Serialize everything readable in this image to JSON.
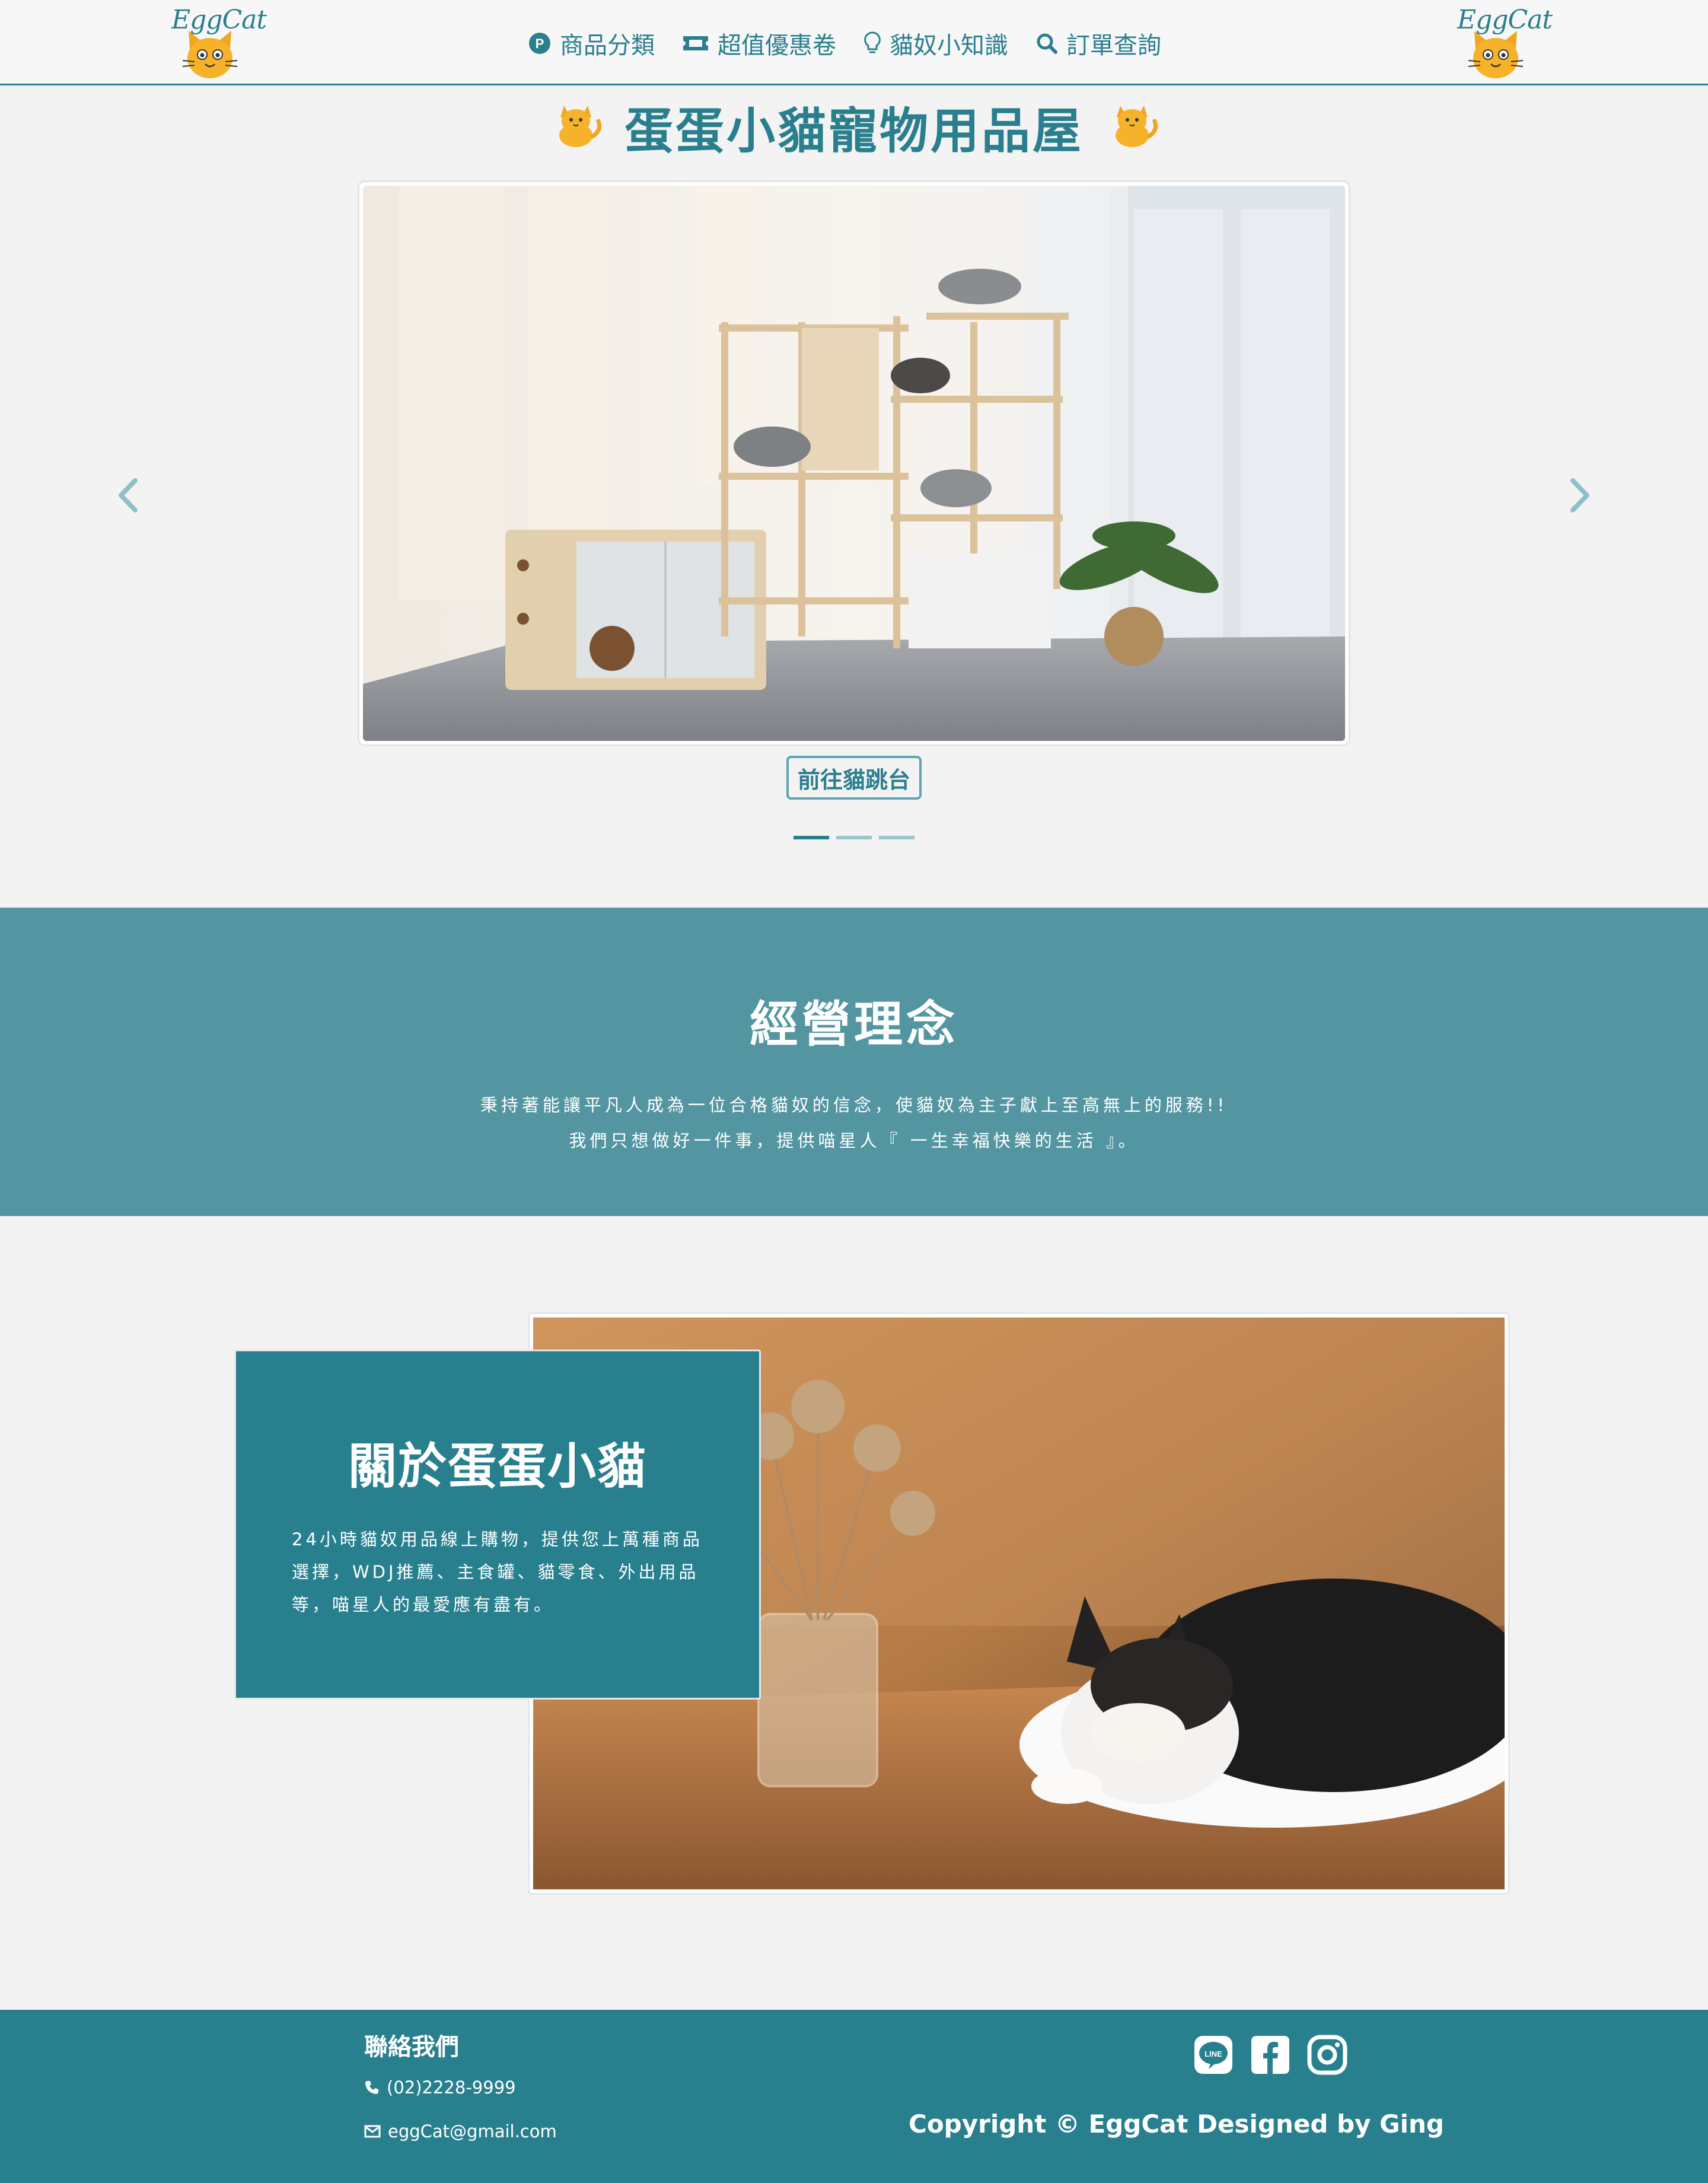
{
  "navbar": {
    "logo_text": "EggCat",
    "items": [
      {
        "label": "商品分類",
        "icon": "p-circle-icon"
      },
      {
        "label": "超值優惠卷",
        "icon": "ticket-icon"
      },
      {
        "label": "貓奴小知識",
        "icon": "lightbulb-icon"
      },
      {
        "label": "訂單查詢",
        "icon": "search-icon"
      }
    ]
  },
  "hero": {
    "title": "蛋蛋小貓寵物用品屋",
    "carousel": {
      "image": "cat-furniture-room-photo",
      "button_label": "前往貓跳台",
      "indicator_count": 3,
      "active_index": 0
    }
  },
  "philosophy": {
    "title": "經營理念",
    "line1": "秉持著能讓平凡人成為一位合格貓奴的信念，使貓奴為主子獻上至高無上的服務!!",
    "line2": "我們只想做好一件事，提供喵星人『 一生幸福快樂的生活 』。"
  },
  "about": {
    "title": "關於蛋蛋小貓",
    "text": "24小時貓奴用品線上購物，提供您上萬種商品選擇，WDJ推薦、主食罐、貓零食、外出用品等，喵星人的最愛應有盡有。",
    "image": "sleeping-cat-photo"
  },
  "footer": {
    "title": "聯絡我們",
    "phone": "(02)2228-9999",
    "email": "eggCat@gmail.com",
    "copyright": "Copyright © EggCat Designed by Ging",
    "social": [
      "line-icon",
      "facebook-icon",
      "instagram-icon"
    ]
  },
  "colors": {
    "primary": "#2a7f8e",
    "philosophy_bg": "#5396a1",
    "page_bg": "#f3f3f3"
  }
}
